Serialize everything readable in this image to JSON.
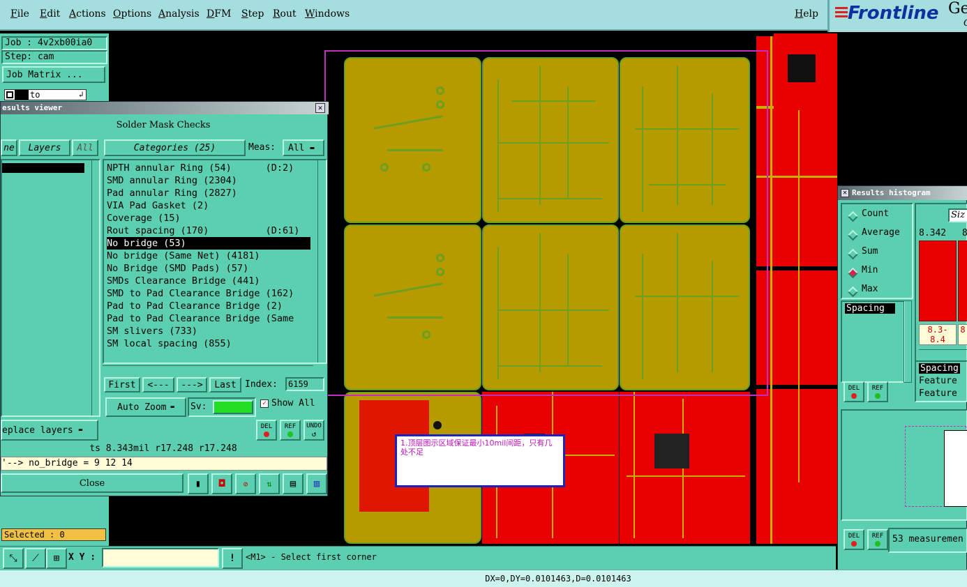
{
  "menu": {
    "items": [
      "File",
      "Edit",
      "Actions",
      "Options",
      "Analysis",
      "DFM",
      "Step",
      "Rout",
      "Windows"
    ],
    "help": "Help"
  },
  "logo": {
    "brand": "Frontline",
    "suffix": "Ge",
    "suffix2": "G"
  },
  "sidebar": {
    "job": "Job : 4v2xb00ia0",
    "step": "Step: cam",
    "job_matrix": "Job Matrix ...",
    "layer_field": "to",
    "selected": "Selected : 0"
  },
  "results_viewer": {
    "title": "esults viewer",
    "heading": "Solder Mask Checks",
    "left_tabs": [
      "ne",
      "Layers",
      "All"
    ],
    "categories_label": "Categories (25)",
    "meas_label": "Meas:",
    "meas_value": "All",
    "categories": [
      "NPTH annular Ring (54)      (D:2)",
      "SMD annular Ring (2304)",
      "Pad annular Ring (2827)",
      "VIA Pad Gasket (2)",
      "Coverage (15)",
      "Rout spacing (170)          (D:61)",
      "No bridge (53)",
      "No bridge (Same Net) (4181)",
      "No Bridge (SMD Pads) (57)",
      "SMDs Clearance Bridge (441)",
      "SMD to Pad Clearance Bridge (162)",
      "Pad to Pad Clearance Bridge (2)",
      "Pad to Pad Clearance Bridge (Same",
      "SM slivers (733)",
      "SM local spacing (855)"
    ],
    "selected_index": 6,
    "nav": {
      "first": "First",
      "prev": "<---",
      "next": "--->",
      "last": "Last",
      "index_label": "Index:",
      "index_value": "6159"
    },
    "auto_zoom": "Auto Zoom",
    "sv_label": "Sv:",
    "show_all": "Show All",
    "replace_layers": "eplace layers",
    "del": "DEL",
    "ref": "REF",
    "undo": "UNDO",
    "measure_line": "ts 8.343mil   r17.248   r17.248",
    "detail_line": "'--> no_bridge = 9 12 14",
    "close": "Close"
  },
  "annotation": {
    "text": "1.顶层图示区域保证最小10mil间距，只有几处不足"
  },
  "histogram": {
    "title": "Results histogram",
    "options": [
      "Count",
      "Average",
      "Sum",
      "Min",
      "Max"
    ],
    "selected_option": "Min",
    "size_label": "Siz",
    "value_top": "8.342",
    "value_top2": "8",
    "range_label": "8.3-\n8.4",
    "range_label2": "8",
    "list_item": "Spacing",
    "feature_rows": [
      "Spacing",
      "Feature",
      "Feature"
    ],
    "measurements": "53 measuremen",
    "del": "DEL",
    "ref": "REF"
  },
  "bottom": {
    "xy_label": "X Y :",
    "prompt": "<M1> - Select first corner",
    "status": "DX=0,DY=0.0101463,D=0.0101463"
  },
  "colors": {
    "teal": "#5ccfb0",
    "board_green": "#b59a00",
    "board_red": "#e80000",
    "trace_green": "#6ca020",
    "selection_box": "#c030c0"
  }
}
